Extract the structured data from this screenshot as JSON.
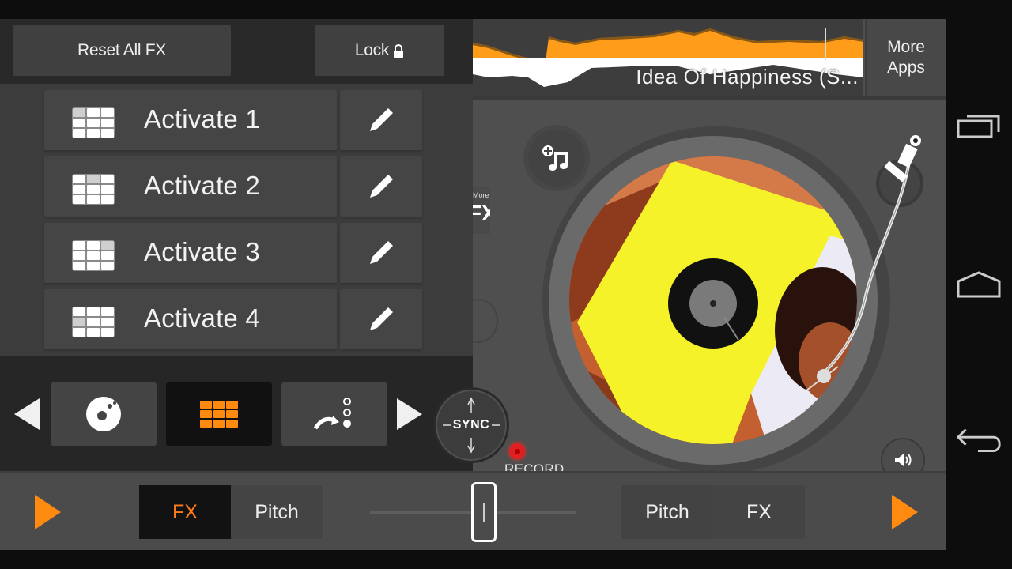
{
  "fx_panel": {
    "reset_label": "Reset All FX",
    "lock_label": "Lock",
    "lock_icon": "lock-icon",
    "fx_slots": [
      {
        "label": "Activate 1",
        "icon": "fx-grid-icon",
        "highlighted_cell": 0,
        "edit_icon": "pencil-icon"
      },
      {
        "label": "Activate 2",
        "icon": "fx-grid-icon",
        "highlighted_cell": 1,
        "edit_icon": "pencil-icon"
      },
      {
        "label": "Activate 3",
        "icon": "fx-grid-icon",
        "highlighted_cell": 2,
        "edit_icon": "pencil-icon"
      },
      {
        "label": "Activate 4",
        "icon": "fx-grid-icon",
        "highlighted_cell": 3,
        "edit_icon": "pencil-icon"
      }
    ],
    "modes": [
      {
        "name": "vinyl",
        "icon": "vinyl-disc-icon",
        "active": false
      },
      {
        "name": "pads",
        "icon": "pad-grid-icon",
        "active": true
      },
      {
        "name": "sequencer",
        "icon": "sequencer-icon",
        "active": false
      }
    ],
    "prev_icon": "triangle-left-icon",
    "next_icon": "triangle-right-icon"
  },
  "deck": {
    "track_title": "Idea Of Happiness (S...",
    "more_apps_line1": "More",
    "more_apps_line2": "Apps",
    "more_fx_small": "More",
    "more_fx_big": "FX",
    "sync_label": "SYNC",
    "record_label": "RECORD",
    "add_music_icon": "add-music-icon",
    "volume_icon": "speaker-icon"
  },
  "bottom_bar": {
    "left_segment": [
      {
        "label": "FX",
        "active": true
      },
      {
        "label": "Pitch",
        "active": false
      }
    ],
    "right_segment": [
      {
        "label": "Pitch",
        "active": false
      },
      {
        "label": "FX",
        "active": false
      }
    ],
    "crossfader_position": 0.5
  },
  "colors": {
    "accent": "#ff8a10",
    "record": "#e02020",
    "waveform_top": "#ff9d1a",
    "waveform_bottom": "#ffffff"
  },
  "android_nav": {
    "recents_icon": "recents-icon",
    "home_icon": "home-icon",
    "back_icon": "back-icon"
  }
}
